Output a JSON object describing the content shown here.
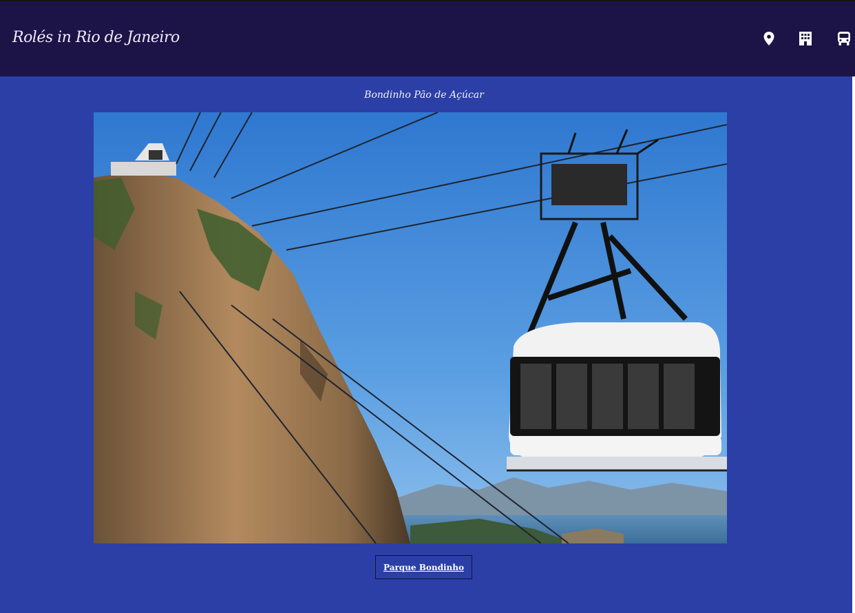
{
  "header": {
    "title": "Rolés in Rio de Janeiro",
    "icons": [
      "location-pin-icon",
      "building-icon",
      "bus-icon"
    ]
  },
  "attraction": {
    "caption": "Bondinho Pão de Açúcar",
    "image_alt": "Cable car approaching Sugarloaf Mountain",
    "link_label": "Parque Bondinho"
  },
  "colors": {
    "header_bg": "#1c1347",
    "page_bg": "#2b3fa6",
    "text": "#f3f0fa"
  }
}
